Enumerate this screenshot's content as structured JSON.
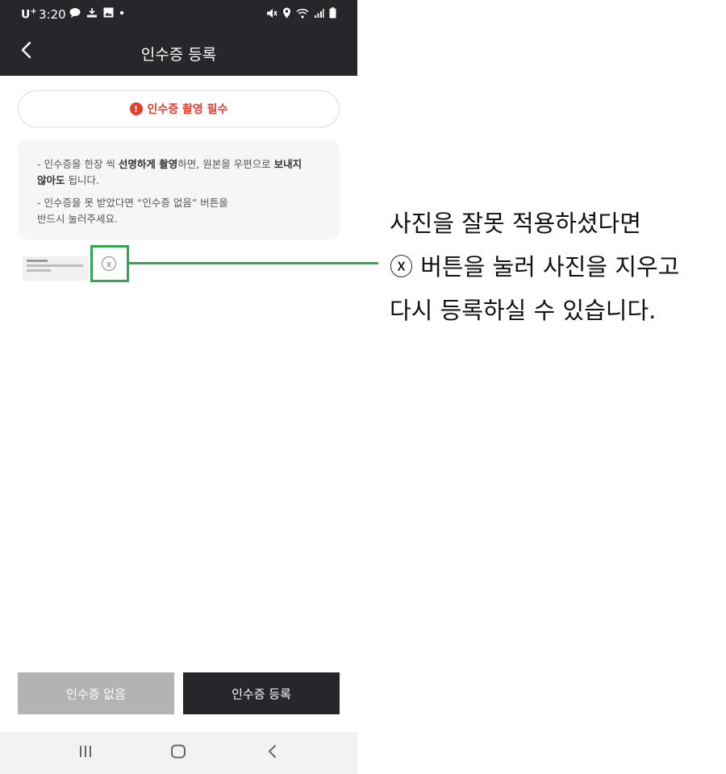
{
  "status_bar": {
    "carrier": "U",
    "carrier_sup": "+",
    "time": "3:20"
  },
  "header": {
    "title": "인수증 등록"
  },
  "notice": {
    "icon": "!",
    "text": "인수증 촬영 필수"
  },
  "info": {
    "line1_pre": "- 인수증을 한장 씩 ",
    "line1_bold1": "선명하게 촬영",
    "line1_mid": "하면, 원본을 우편으로 ",
    "line1_bold2": "보내지",
    "line2_bold": "않아도",
    "line2_post": " 됩니다.",
    "line3": "- 인수증을 못 받았다면 “인수증 없음” 버튼을",
    "line4": "반드시 눌러주세요."
  },
  "photo": {
    "remove_icon": "x"
  },
  "buttons": {
    "none_label": "인수증 없음",
    "register_label": "인수증 등록"
  },
  "callout": {
    "line1": "사진을 잘못 적용하셨다면",
    "line2": "ⓧ 버튼을 눌러 사진을 지우고",
    "line3": "다시 등록하실 수 있습니다."
  },
  "colors": {
    "header_bg": "#25272a",
    "accent_red": "#e53b2c",
    "highlight_green": "#2fa84f",
    "disabled_button": "#b3b3b3"
  },
  "icons": [
    "back-arrow-icon",
    "alert-icon",
    "close-circle-icon",
    "recent-apps-icon",
    "home-icon",
    "nav-back-icon"
  ]
}
